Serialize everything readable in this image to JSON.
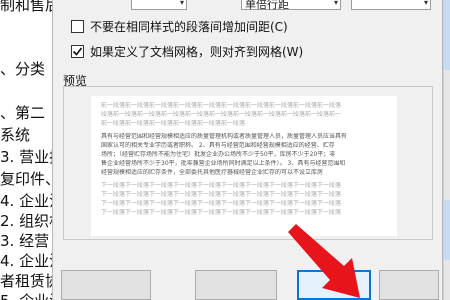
{
  "background_doc": {
    "lines": [
      "制和售后",
      "、分类",
      "、第二",
      "系统",
      "3. 营业执",
      "复印件、",
      "4. 企业法",
      "2. 组织机",
      "3. 经营",
      "4. 企业法",
      "者租赁协",
      "5. 企业法"
    ]
  },
  "dialog": {
    "top_field_1": "",
    "top_field_2": "单倍行距",
    "options": {
      "no_space_same_style": {
        "label": "不要在相同样式的段落间增加间距(C)",
        "checked": false
      },
      "snap_to_grid": {
        "label": "如果定义了文档网格，则对齐到网格(W)",
        "checked": true
      }
    },
    "preview": {
      "title": "预览",
      "gray_lines_top": [
        "前一段落前一段落前一段落前一段落前一段落前一段落前一段落前一段落前一段落前一段落",
        "段落前一段落前一段落前一段落前一段落前一段落前一段落前一段落前一段落前一段落前一",
        "前一段落前一段落前一段落前一段落前一段落前一段落"
      ],
      "body_lines": [
        "具有与经营范围和经营规模相适应的质量管理机构或者质量管理人员，质量管理人员应当具有",
        "国家认可的相关专业学历或者职称。 2、具有与经营范围和经营规模相适应的经营、贮存",
        "场所；（经营贮存场所不能为住宅）批发企业办公场所不少于50平，库房不少于20平；零",
        "售企业经营场所不少于30平，批零兼营企业场所同时满足以上条件）。 3、具有与经营范围和",
        "经营规模相适应的贮存条件，全部委托其他医疗器械经营企业贮存的可以不设立库房"
      ],
      "gray_lines_bottom": [
        "下一段落下一段落下一段落下一段落下一段落下一段落下一段落下一段落下一段落下一段落",
        "下一段落下一段落下一段落下一段落下一段落下一段落下一段落下一段落下一段落下一段落",
        "下一段落下一段落下一段落下一段落下一段落下一段落下一段落下一段落下一段落下一段落",
        "下一段落下一段落下一段落下一段落下一段落下一段落下一段落下一段落下一段落下一段落"
      ]
    },
    "buttons": [
      "",
      "",
      ""
    ]
  },
  "colors": {
    "dialog_bg": "#f0f0f0",
    "accent": "#0078d7",
    "annotation_arrow": "#e8141c"
  }
}
